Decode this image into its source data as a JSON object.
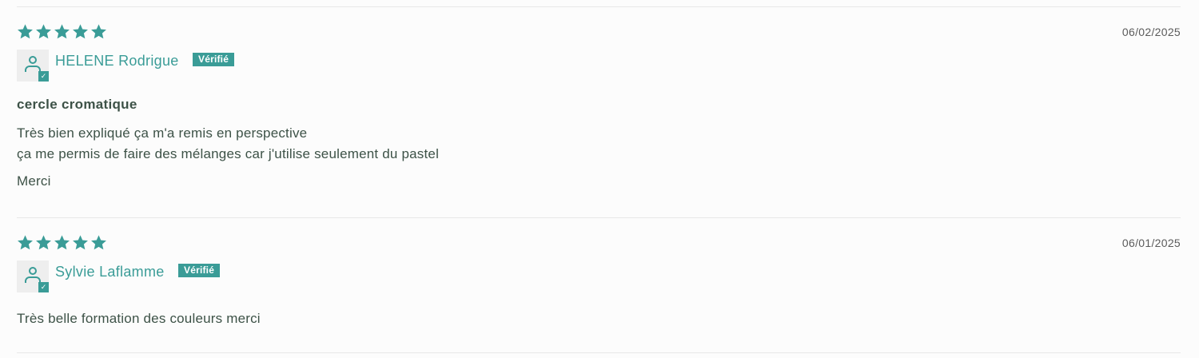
{
  "colors": {
    "accent": "#3a9c97",
    "text": "#3d5247",
    "divider": "#e8e8e8",
    "background": "#fcfcfc"
  },
  "reviews": [
    {
      "rating": 5,
      "date": "06/02/2025",
      "author": "HELENE Rodrigue",
      "verified_label": "Vérifié",
      "title": "cercle cromatique",
      "body_lines": [
        "Très bien expliqué ça m'a remis en perspective",
        "ça me permis de faire des mélanges car j'utilise seulement du pastel",
        "Merci"
      ]
    },
    {
      "rating": 5,
      "date": "06/01/2025",
      "author": "Sylvie Laflamme",
      "verified_label": "Vérifié",
      "title": "",
      "body_lines": [
        "Très belle formation des couleurs merci"
      ]
    }
  ],
  "icons": {
    "star": "star-icon",
    "avatar": "user-avatar-icon",
    "verified_check": "check-icon"
  }
}
